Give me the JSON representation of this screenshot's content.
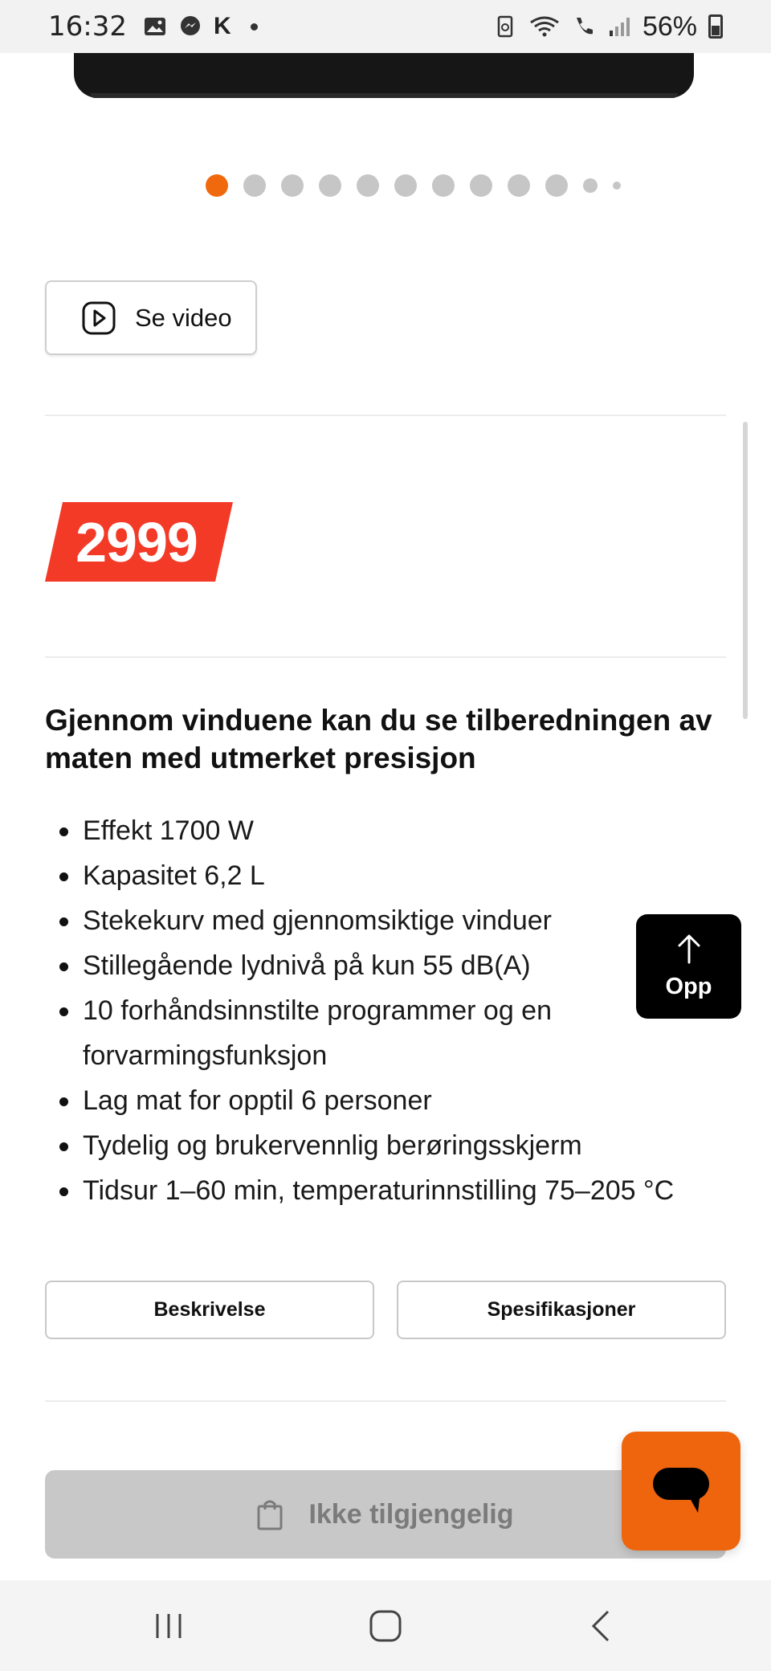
{
  "status_bar": {
    "time": "16:32",
    "notification_icons": [
      "image-icon",
      "messenger-icon",
      "klarna-k-icon",
      "dot-icon"
    ],
    "k_glyph": "K",
    "battery_percent": "56%"
  },
  "carousel": {
    "total_dots": 12,
    "active_index": 0
  },
  "video_button": {
    "label": "Se video"
  },
  "price": {
    "amount": "2999",
    "badge_color": "#f33a27"
  },
  "product": {
    "headline": "Gjennom vinduene kan du se tilberedningen av maten med utmerket presisjon",
    "features": [
      "Effekt 1700 W",
      "Kapasitet 6,2 L",
      "Stekekurv med gjennomsiktige vinduer",
      "Stillegående lydnivå på kun 55 dB(A)",
      "10 forhåndsinnstilte programmer og en forvarmingsfunksjon",
      "Lag mat for opptil 6 personer",
      "Tydelig og brukervennlig berøringsskjerm",
      "Tidsur 1–60 min, temperaturinnstilling 75–205 °C"
    ]
  },
  "back_to_top": {
    "label": "Opp"
  },
  "tabs": {
    "description": "Beskrivelse",
    "specifications": "Spesifikasjoner"
  },
  "purchase": {
    "label": "Ikke tilgjengelig",
    "disabled": true
  },
  "chat": {
    "accent": "#ee650e"
  },
  "navbar": {
    "icons": [
      "recent-apps-icon",
      "home-icon",
      "back-icon"
    ]
  }
}
